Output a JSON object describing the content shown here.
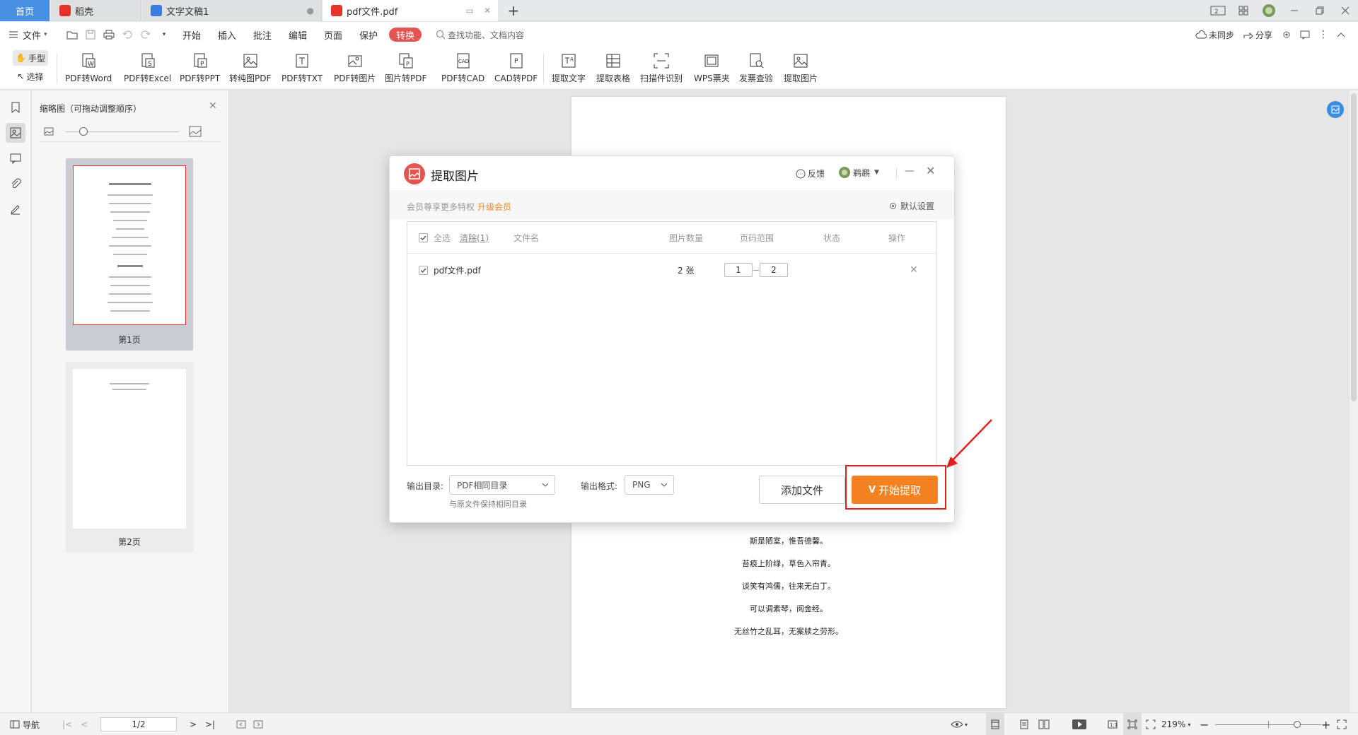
{
  "tabs": {
    "home": "首页",
    "daoke": "稻壳",
    "doc": "文字文稿1",
    "pdf": "pdf文件.pdf"
  },
  "menubar": {
    "file": "文件",
    "items": [
      "开始",
      "插入",
      "批注",
      "编辑",
      "页面",
      "保护"
    ],
    "convert": "转换",
    "search_placeholder": "查找功能、文档内容",
    "sync": "未同步",
    "share": "分享"
  },
  "tools": {
    "hand": "手型",
    "select": "选择"
  },
  "ribbon": [
    {
      "label": "PDF转Word",
      "icon": "pdf-to-word-icon"
    },
    {
      "label": "PDF转Excel",
      "icon": "pdf-to-excel-icon"
    },
    {
      "label": "PDF转PPT",
      "icon": "pdf-to-ppt-icon"
    },
    {
      "label": "转纯图PDF",
      "icon": "image-pdf-icon"
    },
    {
      "label": "PDF转TXT",
      "icon": "pdf-to-txt-icon"
    },
    {
      "label": "PDF转图片",
      "icon": "pdf-to-image-icon"
    },
    {
      "label": "图片转PDF",
      "icon": "image-to-pdf-icon"
    },
    {
      "label": "PDF转CAD",
      "icon": "pdf-to-cad-icon"
    },
    {
      "label": "CAD转PDF",
      "icon": "cad-to-pdf-icon"
    },
    {
      "label": "提取文字",
      "icon": "extract-text-icon"
    },
    {
      "label": "提取表格",
      "icon": "extract-table-icon"
    },
    {
      "label": "扫描件识别",
      "icon": "scan-recognize-icon"
    },
    {
      "label": "WPS票夹",
      "icon": "ticket-folder-icon"
    },
    {
      "label": "发票查验",
      "icon": "invoice-check-icon"
    },
    {
      "label": "提取图片",
      "icon": "extract-image-icon"
    }
  ],
  "thumbnail_panel": {
    "title": "缩略图（可拖动调整顺序）",
    "pages": [
      "第1页",
      "第2页"
    ]
  },
  "document": {
    "lines": [
      "斯是陋室，惟吾德馨。",
      "苔痕上阶绿，草色入帘青。",
      "谈笑有鸿儒，往来无白丁。",
      "可以调素琴，阅金经。",
      "无丝竹之乱耳，无案牍之劳形。"
    ]
  },
  "dialog": {
    "title": "提取图片",
    "feedback": "反馈",
    "user": "鹈鹕",
    "promo": "会员尊享更多特权",
    "upgrade": "升级会员",
    "settings": "默认设置",
    "headers": {
      "select_all": "全选",
      "clear": "清除(1)",
      "filename": "文件名",
      "count": "图片数量",
      "range": "页码范围",
      "status": "状态",
      "action": "操作"
    },
    "row": {
      "filename": "pdf文件.pdf",
      "count": "2 张",
      "from": "1",
      "to": "2"
    },
    "output_dir_label": "输出目录:",
    "output_dir": "PDF相同目录",
    "output_dir_hint": "与原文件保持相同目录",
    "format_label": "输出格式:",
    "format": "PNG",
    "add_file": "添加文件",
    "start": "开始提取"
  },
  "statusbar": {
    "nav": "导航",
    "page": "1/2",
    "zoom": "219%"
  },
  "colors": {
    "accent": "#f58220",
    "convert": "#e45450",
    "highlight": "#e02020"
  }
}
